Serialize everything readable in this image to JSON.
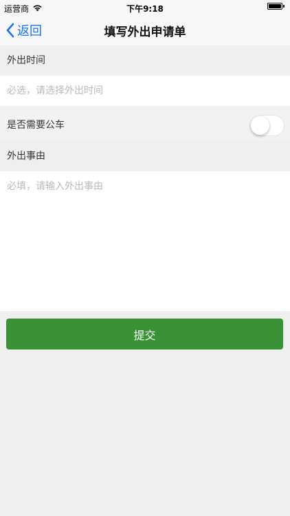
{
  "status_bar": {
    "carrier": "运营商",
    "time": "下午9:18"
  },
  "nav": {
    "back_label": "返回",
    "title": "填写外出申请单"
  },
  "form": {
    "time_section_label": "外出时间",
    "time_placeholder": "必选，请选择外出时间",
    "car_label": "是否需要公车",
    "car_toggle_on": false,
    "reason_section_label": "外出事由",
    "reason_placeholder": "必填，请输入外出事由",
    "reason_value": ""
  },
  "submit_label": "提交",
  "colors": {
    "accent_blue": "#1a73e8",
    "submit_green": "#3a9236",
    "background": "#efefef"
  },
  "icons": {
    "back": "chevron-left-icon",
    "wifi": "wifi-icon",
    "battery": "battery-icon"
  }
}
